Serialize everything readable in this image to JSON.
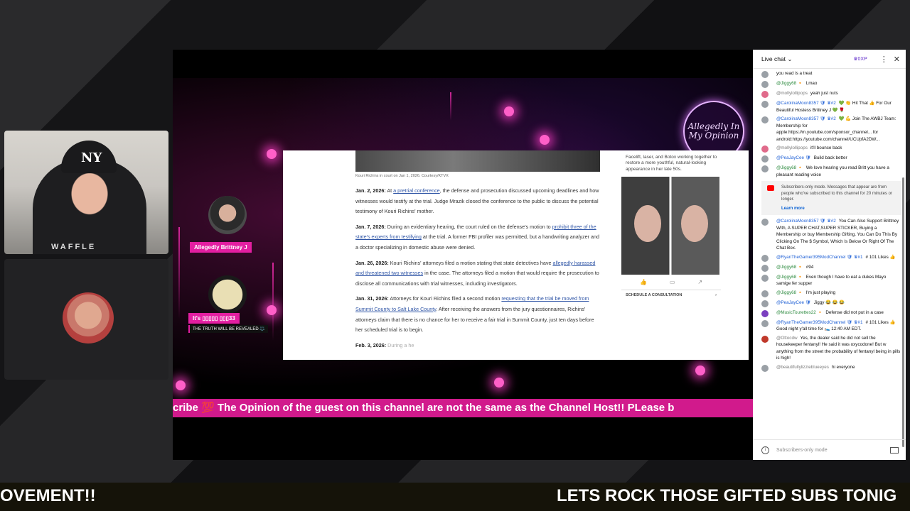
{
  "webcam": {
    "cap_logo": "NY",
    "shirt_text": "WAFFLE"
  },
  "stage": {
    "logo_text": "Allegedly In My Opinion",
    "guest1_name": "Allegedly Brittney J",
    "guest2_name": "It's ▯▯▯▯▯ ▯▯▯33",
    "guest2_sub": "THE TRUTH WILL BE REVEALED ⚖️",
    "ticker": "cribe 💯 The Opinion of the guest on this channel are not the same as the Channel Host!! PLease b"
  },
  "document": {
    "caption": "Kouri Richins in court on Jan 1, 2026. Courtesy/KTVX",
    "entries": [
      {
        "date": "Jan. 2, 2026:",
        "pre": " At ",
        "link": "a pretrial conference",
        "post": ", the defense and prosecution discussed upcoming deadlines and how witnesses would testify at the trial. Judge Mrazik closed the conference to the public to discuss the potential testimony of Kouri Richins' mother."
      },
      {
        "date": "Jan. 7, 2026:",
        "pre": " During an evidentiary hearing, the court ruled on the defense's motion to ",
        "link": "prohibit three of the state's experts from testifying",
        "post": " at the trial. A former FBI profiler was permitted, but a handwriting analyzer and a doctor specializing in domestic abuse were denied."
      },
      {
        "date": "Jan. 26, 2026:",
        "pre": " Kouri Richins' attorneys filed a motion stating that state detectives have ",
        "link": "allegedly harassed and threatened two witnesses",
        "post": " in the case. The attorneys filed a motion that would require the prosecution to disclose all communications with trial witnesses, including investigators."
      },
      {
        "date": "Jan. 31, 2026:",
        "pre": " Attorneys for Kouri Richins filed a second motion ",
        "link": "requesting that the trial be moved from Summit County to Salt Lake County",
        "post": ". After receiving the answers from the jury questionnaires, Richins' attorneys claim that there is no chance for her to receive a fair trial in Summit County, just ten days before her scheduled trial is to begin."
      },
      {
        "date": "Feb. 3, 2026:",
        "pre": " During a he",
        "link": "",
        "post": ""
      }
    ],
    "ad_text": "Facelift, laser, and Botox working together to restore a more youthful, natural-looking appearance in her late 50s.",
    "ad_button": "SCHEDULE A CONSULTATION",
    "ad_chevron": "›"
  },
  "chat": {
    "title": "Live chat",
    "xp": "♛0XP",
    "notice": "Subscribers-only mode. Messages that appear are from people who've subscribed to this channel for 20 minutes or longer.",
    "notice_link": "Learn more",
    "footer": "Subscribers-only mode",
    "avatar_colors": {
      "default": "#9aa0a6",
      "pink": "#e06b8b",
      "purple": "#7b3fbf",
      "red": "#c0392b"
    },
    "messages": [
      {
        "user": "",
        "text": "you read is a treat",
        "avatar": "default",
        "type": ""
      },
      {
        "user": "@Jiggy68 🔸",
        "text": "Lmao",
        "avatar": "default",
        "type": "member"
      },
      {
        "user": "@mollylollipops",
        "text": "yeah just nuts",
        "avatar": "pink",
        "type": ""
      },
      {
        "user": "@CarolinaMoon8357 🛡 ♛#2",
        "text": "💚 👏 Hit That 👍 For Our Beautiful Hostess Brittney J 💚 🌹",
        "avatar": "default",
        "type": "mod"
      },
      {
        "user": "@CarolinaMoon8357 🛡 ♛#2",
        "text": "💚 💪 Join The AWBJ Team: Membership for apple:https://m.youtube.com/sponsor_channel... for android:https://youtube.com/channel/UCUpfA2DW...",
        "avatar": "default",
        "type": "mod"
      },
      {
        "user": "@mollylollipops",
        "text": "it'll bounce back",
        "avatar": "pink",
        "type": ""
      },
      {
        "user": "@PeaJayCee 🛡",
        "text": "Build back better",
        "avatar": "default",
        "type": "mod"
      },
      {
        "user": "@Jiggy68 🔸",
        "text": "We love hearing you read Britt you have a pleasant reading voice",
        "avatar": "default",
        "type": "member"
      },
      {
        "user": "@CarolinaMoon8357 🛡 ♛#2",
        "text": "You Can Also Support Brittney With, A SUPER CHAT,SUPER STICKER, Buying a Membership or buy Membership Gifting. You Can Do This By Clicking On The $ Symbol, Which Is Below Or Right Of The Chat Box.",
        "avatar": "default",
        "type": "mod"
      },
      {
        "user": "@RyanTheGamer395ModChannel 🛡 ♛#1",
        "text": "# 101 Likes 👍",
        "avatar": "default",
        "type": "mod"
      },
      {
        "user": "@Jiggy68 🔸",
        "text": "#94",
        "avatar": "default",
        "type": "member"
      },
      {
        "user": "@Jiggy68 🔸",
        "text": "Even though I have to eat a dukes Mayo samige fer supper",
        "avatar": "default",
        "type": "member"
      },
      {
        "user": "@Jiggy68 🔸",
        "text": "I'm just playing",
        "avatar": "default",
        "type": "member"
      },
      {
        "user": "@PeaJayCee 🛡",
        "text": "Jiggy 😂 😂 😂",
        "avatar": "default",
        "type": "mod"
      },
      {
        "user": "@MusicTourettes22 🔸",
        "text": "Defense did not put in a case",
        "avatar": "purple",
        "type": "member"
      },
      {
        "user": "@RyanTheGamer395ModChannel 🛡 ♛#1",
        "text": "# 101 Likes 👍 Good night y'all time for 🛌 12:40 AM EDT.",
        "avatar": "default",
        "type": "mod"
      },
      {
        "user": "@Ottocdw",
        "text": "Yes, the dealer said he did not sell the housekeeper fentanyl! He said it was oxycodone! But w anything from the street the probability of fentanyl being in pills is high!",
        "avatar": "red",
        "type": ""
      },
      {
        "user": "@beautifullylizzieblueeyes",
        "text": "hi everyone",
        "avatar": "default",
        "type": ""
      }
    ]
  },
  "banner": {
    "left": "OVEMENT!!",
    "right": "LETS ROCK THOSE GIFTED SUBS TONIG"
  }
}
